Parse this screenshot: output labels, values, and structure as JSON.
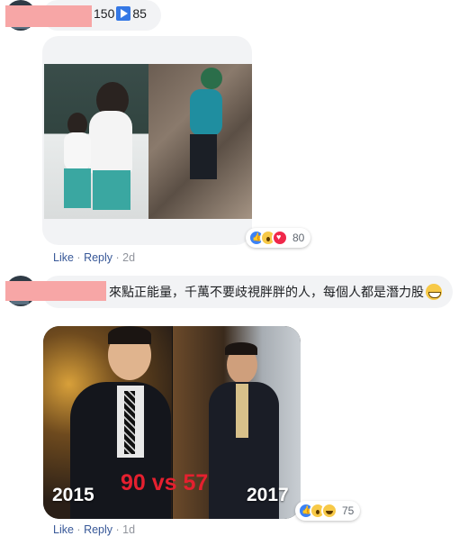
{
  "comment1": {
    "text_before": "150",
    "text_after": "85",
    "reactions_count": "80",
    "like_label": "Like",
    "reply_label": "Reply",
    "separator": "·",
    "timestamp": "2d"
  },
  "comment2": {
    "text": "來點正能量，千萬不要歧視胖胖的人，每個人都是潛力股",
    "year_left": "2015",
    "year_right": "2017",
    "weights": "90 vs 57",
    "reactions_count": "75",
    "like_label": "Like",
    "reply_label": "Reply",
    "separator": "·",
    "timestamp": "1d"
  },
  "colors": {
    "link": "#385898",
    "meta": "#90949c",
    "bubble": "#f2f3f5",
    "redaction": "#f7a6a6"
  }
}
